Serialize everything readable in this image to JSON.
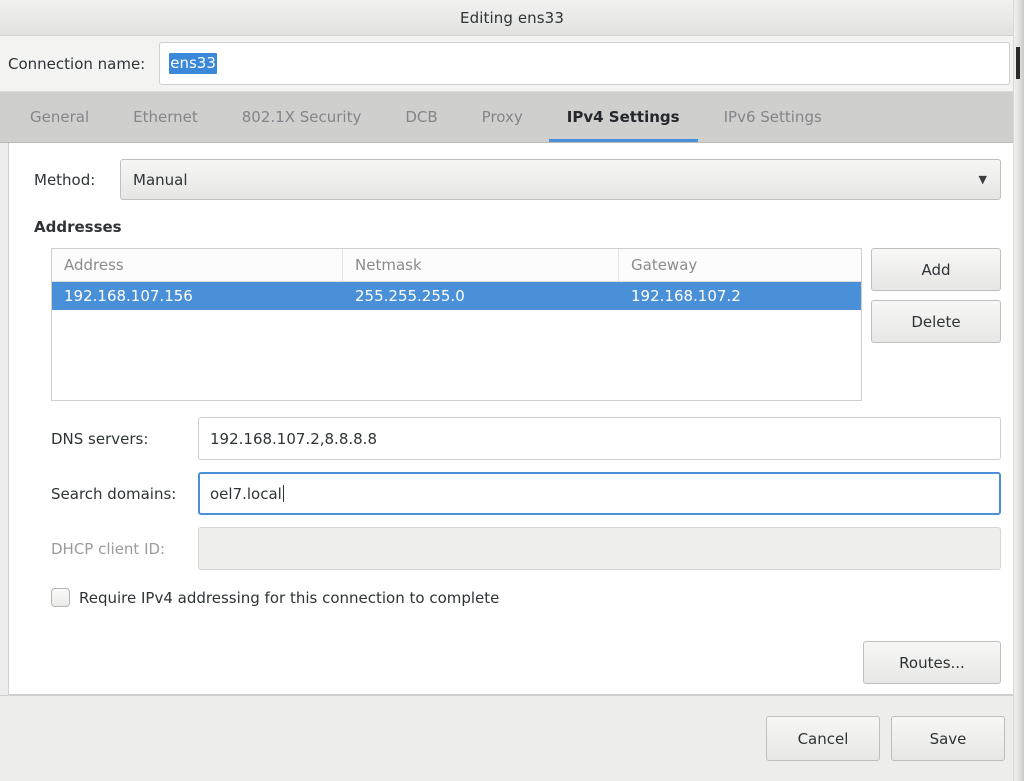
{
  "window": {
    "title": "Editing ens33"
  },
  "connection": {
    "label": "Connection name:",
    "value": "ens33",
    "selected": true
  },
  "tabs": [
    {
      "label": "General",
      "active": false
    },
    {
      "label": "Ethernet",
      "active": false
    },
    {
      "label": "802.1X Security",
      "active": false
    },
    {
      "label": "DCB",
      "active": false
    },
    {
      "label": "Proxy",
      "active": false
    },
    {
      "label": "IPv4 Settings",
      "active": true
    },
    {
      "label": "IPv6 Settings",
      "active": false
    }
  ],
  "ipv4": {
    "method_label": "Method:",
    "method_value": "Manual",
    "addresses_title": "Addresses",
    "table": {
      "columns": [
        "Address",
        "Netmask",
        "Gateway"
      ],
      "rows": [
        {
          "address": "192.168.107.156",
          "netmask": "255.255.255.0",
          "gateway": "192.168.107.2",
          "selected": true
        }
      ]
    },
    "add_label": "Add",
    "delete_label": "Delete",
    "dns_label": "DNS servers:",
    "dns_value": "192.168.107.2,8.8.8.8",
    "search_label": "Search domains:",
    "search_value": "oel7.local",
    "dhcp_label": "DHCP client ID:",
    "dhcp_value": "",
    "require_label": "Require IPv4 addressing for this connection to complete",
    "require_checked": false,
    "routes_label": "Routes..."
  },
  "actions": {
    "cancel_label": "Cancel",
    "save_label": "Save"
  },
  "colors": {
    "accent": "#4a90d9",
    "selection": "#3b87d8",
    "tab_inactive_text": "#84858a",
    "text": "#2e3436",
    "window_bg": "#ededed",
    "tabbar_bg": "#cfcfcd"
  }
}
